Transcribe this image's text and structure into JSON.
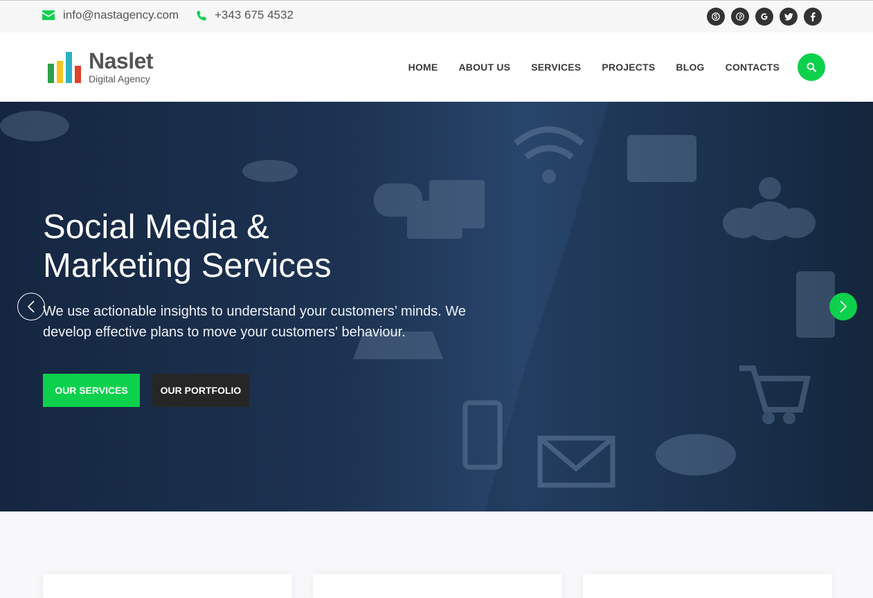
{
  "topbar": {
    "email": "info@nastagency.com",
    "phone": "+343 675 4532",
    "email_icon": "envelope-icon",
    "phone_icon": "phone-icon",
    "socials": [
      "skype-icon",
      "pinterest-icon",
      "google-icon",
      "twitter-icon",
      "facebook-icon"
    ]
  },
  "header": {
    "logo": {
      "name": "Naslet",
      "tagline": "Digital Agency"
    },
    "nav": [
      "HOME",
      "ABOUT US",
      "SERVICES",
      "PROJECTS",
      "BLOG",
      "CONTACTS"
    ],
    "search_icon": "search-icon"
  },
  "hero": {
    "title_line1": "Social Media &",
    "title_line2": "Marketing Services",
    "description": "We use actionable insights to understand your customers’ minds. We develop effective plans to move your customers' behaviour.",
    "primary_button": "OUR SERVICES",
    "secondary_button": "OUR PORTFOLIO",
    "prev_icon": "chevron-left-icon",
    "next_icon": "chevron-right-icon"
  },
  "colors": {
    "accent": "#0dd14c",
    "dark": "#262626",
    "hero_bg": "#1d3352",
    "logo_bars": [
      "#2da04a",
      "#f7c520",
      "#2bb1c4",
      "#e0422a"
    ]
  }
}
